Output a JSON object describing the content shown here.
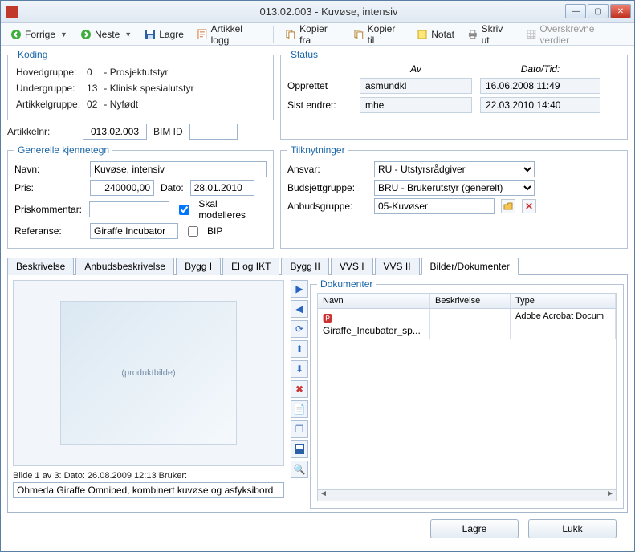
{
  "window": {
    "title": "013.02.003 - Kuvøse, intensiv"
  },
  "toolbar": {
    "forrige": "Forrige",
    "neste": "Neste",
    "lagre": "Lagre",
    "artikkel_logg": "Artikkel logg",
    "kopier_fra": "Kopier fra",
    "kopier_til": "Kopier til",
    "notat": "Notat",
    "skriv_ut": "Skriv ut",
    "overskrevne": "Overskrevne verdier"
  },
  "koding": {
    "legend": "Koding",
    "rows": {
      "hoved": {
        "label": "Hovedgruppe:",
        "code": "0",
        "desc": "- Prosjektutstyr"
      },
      "under": {
        "label": "Undergruppe:",
        "code": "13",
        "desc": "- Klinisk spesialutstyr"
      },
      "artikkel": {
        "label": "Artikkelgruppe:",
        "code": "02",
        "desc": "- Nyfødt"
      }
    },
    "artikkelnr_label": "Artikkelnr:",
    "artikkelnr": "013.02.003",
    "bimid_label": "BIM ID",
    "bimid": ""
  },
  "status": {
    "legend": "Status",
    "av_hdr": "Av",
    "dato_hdr": "Dato/Tid:",
    "opprettet_label": "Opprettet",
    "opprettet_av": "asmundkl",
    "opprettet_dato": "16.06.2008 11:49",
    "endret_label": "Sist endret:",
    "endret_av": "mhe",
    "endret_dato": "22.03.2010 14:40"
  },
  "generelle": {
    "legend": "Generelle kjennetegn",
    "navn_label": "Navn:",
    "navn": "Kuvøse, intensiv",
    "pris_label": "Pris:",
    "pris": "240000,00",
    "dato_label": "Dato:",
    "dato": "28.01.2010",
    "priskommentar_label": "Priskommentar:",
    "priskommentar": "",
    "skal_modelleres": "Skal modelleres",
    "referanse_label": "Referanse:",
    "referanse": "Giraffe Incubator",
    "bip": "BIP"
  },
  "tilknytninger": {
    "legend": "Tilknytninger",
    "ansvar_label": "Ansvar:",
    "ansvar": "RU - Utstyrsrådgiver",
    "budsjett_label": "Budsjettgruppe:",
    "budsjett": "BRU - Brukerutstyr (generelt)",
    "anbud_label": "Anbudsgruppe:",
    "anbud": "05-Kuvøser"
  },
  "tabs": {
    "beskrivelse": "Beskrivelse",
    "anbud": "Anbudsbeskrivelse",
    "bygg1": "Bygg I",
    "el": "El og IKT",
    "bygg2": "Bygg II",
    "vvs1": "VVS I",
    "vvs2": "VVS II",
    "bilder": "Bilder/Dokumenter"
  },
  "image_pane": {
    "caption": "Bilde 1 av 3: Dato: 26.08.2009 12:13 Bruker:",
    "desc": "Ohmeda Giraffe Omnibed, kombinert kuvøse og asfyksibord",
    "placeholder": "(produktbilde)"
  },
  "documents": {
    "legend": "Dokumenter",
    "cols": {
      "navn": "Navn",
      "beskrivelse": "Beskrivelse",
      "type": "Type"
    },
    "rows": [
      {
        "navn": "Giraffe_Incubator_sp...",
        "beskrivelse": "",
        "type": "Adobe Acrobat Docum"
      }
    ]
  },
  "footer": {
    "lagre": "Lagre",
    "lukk": "Lukk"
  }
}
